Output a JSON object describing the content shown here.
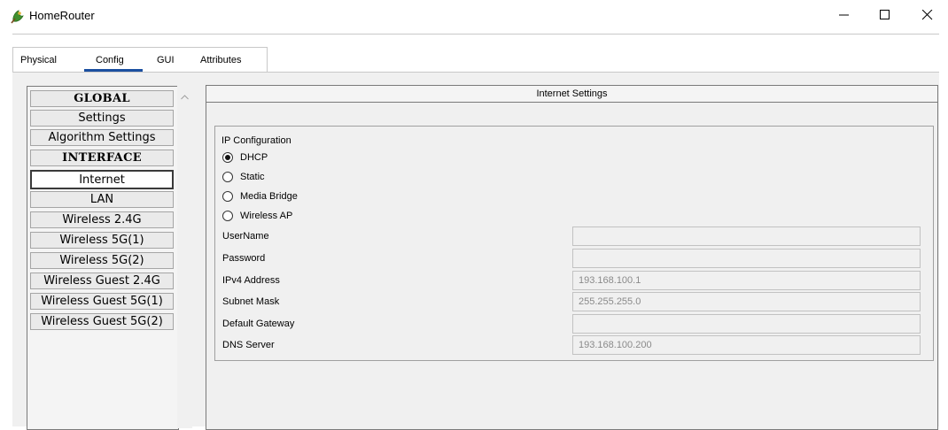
{
  "window": {
    "title": "HomeRouter",
    "icon": "router-leaf-icon",
    "controls": [
      "minimize-icon",
      "maximize-icon",
      "close-icon"
    ]
  },
  "tabs": [
    {
      "label": "Physical"
    },
    {
      "label": "Config",
      "active": true
    },
    {
      "label": "GUI"
    },
    {
      "label": "Attributes"
    }
  ],
  "sidebar": {
    "items": [
      {
        "label": "GLOBAL",
        "type": "header"
      },
      {
        "label": "Settings"
      },
      {
        "label": "Algorithm Settings"
      },
      {
        "label": "INTERFACE",
        "type": "header"
      },
      {
        "label": "Internet",
        "selected": true
      },
      {
        "label": "LAN"
      },
      {
        "label": "Wireless 2.4G"
      },
      {
        "label": "Wireless 5G(1)"
      },
      {
        "label": "Wireless 5G(2)"
      },
      {
        "label": "Wireless Guest 2.4G"
      },
      {
        "label": "Wireless Guest 5G(1)"
      },
      {
        "label": "Wireless Guest 5G(2)"
      }
    ]
  },
  "panel": {
    "title": "Internet Settings",
    "ip_config": {
      "label": "IP Configuration",
      "options": [
        {
          "label": "DHCP",
          "selected": true
        },
        {
          "label": "Static",
          "selected": false
        },
        {
          "label": "Media Bridge",
          "selected": false
        },
        {
          "label": "Wireless AP",
          "selected": false
        }
      ]
    },
    "fields": [
      {
        "label": "UserName",
        "value": ""
      },
      {
        "label": "Password",
        "value": ""
      },
      {
        "label": "IPv4 Address",
        "value": "193.168.100.1"
      },
      {
        "label": "Subnet Mask",
        "value": "255.255.255.0"
      },
      {
        "label": "Default Gateway",
        "value": ""
      },
      {
        "label": "DNS Server",
        "value": "193.168.100.200"
      }
    ]
  },
  "colors": {
    "tab_underline": "#1b4fa0",
    "content_background": "#f0f0f0"
  }
}
